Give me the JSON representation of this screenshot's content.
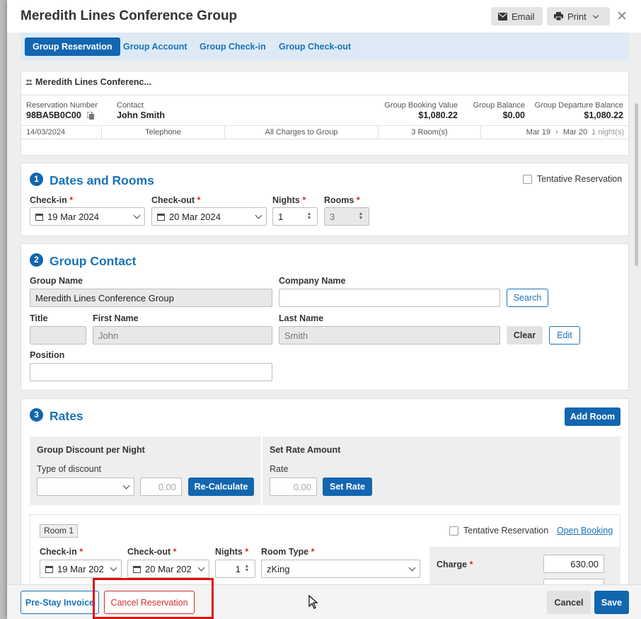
{
  "header": {
    "title": "Meredith Lines Conference Group",
    "email_label": "Email",
    "print_label": "Print"
  },
  "tabs": [
    "Group Reservation",
    "Group Account",
    "Group Check-in",
    "Group Check-out"
  ],
  "summary": {
    "group_name": "Meredith Lines Conferenc...",
    "reservation_number_label": "Reservation Number",
    "reservation_number": "98BA5B0C00",
    "contact_label": "Contact",
    "contact": "John Smith",
    "booking_value_label": "Group Booking Value",
    "booking_value": "$1,080.22",
    "balance_label": "Group Balance",
    "balance": "$0.00",
    "departure_balance_label": "Group Departure Balance",
    "departure_balance": "$1,080.22",
    "row": {
      "date": "14/03/2024",
      "source": "Telephone",
      "charges": "All Charges to Group",
      "rooms": "3 Room(s)",
      "from": "Mar 19",
      "to": "Mar 20",
      "nights": "1 night(s)"
    }
  },
  "dates_rooms": {
    "number": "1",
    "title": "Dates and Rooms",
    "tentative_label": "Tentative Reservation",
    "checkin_label": "Check-in",
    "checkin_value": "19 Mar 2024",
    "checkout_label": "Check-out",
    "checkout_value": "20 Mar 2024",
    "nights_label": "Nights",
    "nights_value": "1",
    "rooms_label": "Rooms",
    "rooms_value": "3"
  },
  "group_contact": {
    "number": "2",
    "title": "Group Contact",
    "group_name_label": "Group Name",
    "group_name_value": "Meredith Lines Conference Group",
    "company_label": "Company Name",
    "company_value": "",
    "search_label": "Search",
    "title_label": "Title",
    "first_name_label": "First Name",
    "first_name_value": "John",
    "last_name_label": "Last Name",
    "last_name_value": "Smith",
    "clear_label": "Clear",
    "edit_label": "Edit",
    "position_label": "Position",
    "position_value": ""
  },
  "rates": {
    "number": "3",
    "title": "Rates",
    "add_room_label": "Add Room",
    "discount_title": "Group Discount per Night",
    "discount_type_label": "Type of discount",
    "discount_amount": "0.00",
    "recalc_label": "Re-Calculate",
    "set_rate_title": "Set Rate Amount",
    "rate_label": "Rate",
    "rate_value": "0.00",
    "set_rate_label": "Set Rate"
  },
  "room1": {
    "badge": "Room 1",
    "tentative_label": "Tentative Reservation",
    "open_booking_label": "Open Booking",
    "checkin_label": "Check-in",
    "checkin_value": "19 Mar 202",
    "checkout_label": "Check-out",
    "checkout_value": "20 Mar 202",
    "nights_label": "Nights",
    "nights_value": "1",
    "room_type_label": "Room Type",
    "room_type_value": "zKing",
    "charge_label": "Charge",
    "charge_value": "630.00"
  },
  "footer": {
    "pre_stay_label": "Pre-Stay Invoice",
    "cancel_res_label": "Cancel Reservation",
    "cancel_label": "Cancel",
    "save_label": "Save"
  },
  "colors": {
    "primary": "#1266b0",
    "link": "#1a73b8",
    "danger": "#d32f2f",
    "highlight": "#e01010"
  }
}
